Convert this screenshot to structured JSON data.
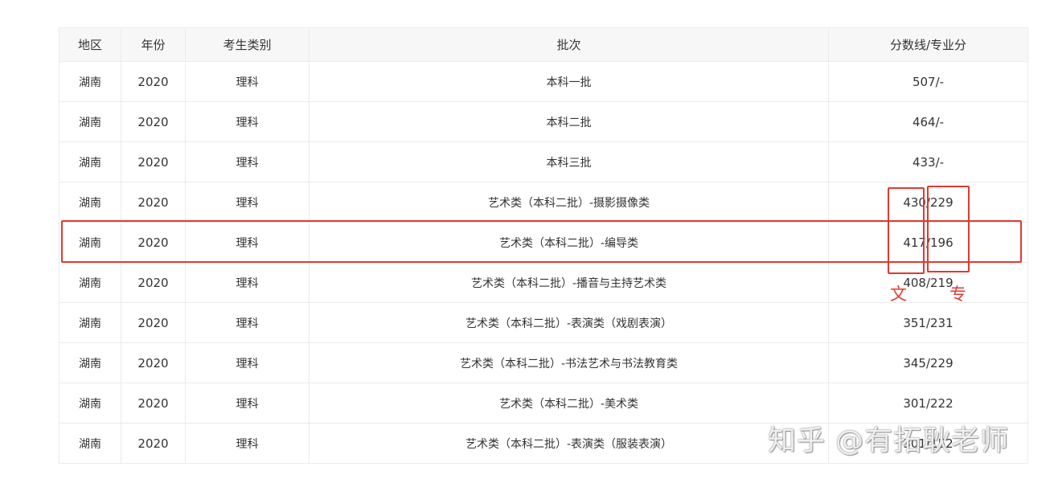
{
  "table": {
    "headers": [
      "地区",
      "年份",
      "考生类别",
      "批次",
      "分数线/专业分"
    ],
    "rows": [
      [
        "湖南",
        "2020",
        "理科",
        "本科一批",
        "507/-"
      ],
      [
        "湖南",
        "2020",
        "理科",
        "本科二批",
        "464/-"
      ],
      [
        "湖南",
        "2020",
        "理科",
        "本科三批",
        "433/-"
      ],
      [
        "湖南",
        "2020",
        "理科",
        "艺术类（本科二批）-摄影摄像类",
        "430/229"
      ],
      [
        "湖南",
        "2020",
        "理科",
        "艺术类（本科二批）-编导类",
        "417/196"
      ],
      [
        "湖南",
        "2020",
        "理科",
        "艺术类（本科二批）-播音与主持艺术类",
        "408/219"
      ],
      [
        "湖南",
        "2020",
        "理科",
        "艺术类（本科二批）-表演类（戏剧表演）",
        "351/231"
      ],
      [
        "湖南",
        "2020",
        "理科",
        "艺术类（本科二批）-书法艺术与书法教育类",
        "345/229"
      ],
      [
        "湖南",
        "2020",
        "理科",
        "艺术类（本科二批）-美术类",
        "301/222"
      ],
      [
        "湖南",
        "2020",
        "理科",
        "艺术类（本科二批）-表演类（服装表演）",
        "301/152"
      ]
    ]
  },
  "annotations": {
    "label_left": "文",
    "label_right": "专",
    "color": "#e03a31"
  },
  "watermark": {
    "text": "知乎 @有拓耿老师"
  }
}
